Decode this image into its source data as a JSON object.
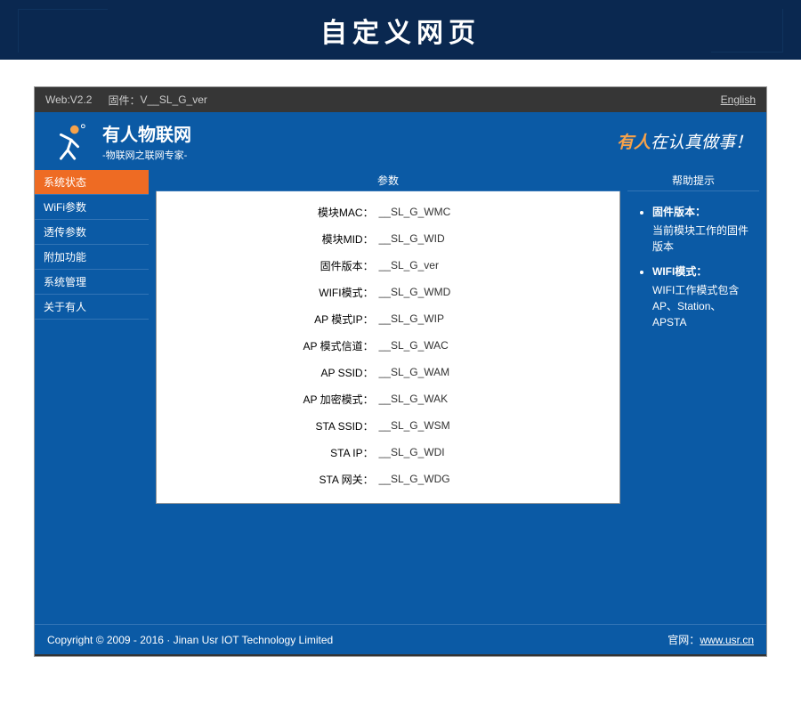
{
  "banner": {
    "title": "自定义网页"
  },
  "topbar": {
    "web": "Web:V2.2",
    "firmware_label": "固件：",
    "firmware_value": "V__SL_G_ver",
    "lang": "English"
  },
  "header": {
    "brand_title": "有人物联网",
    "brand_sub": "-物联网之联网专家-",
    "slogan_highlight": "有人",
    "slogan_rest": "在认真做事！"
  },
  "sidebar": {
    "items": [
      {
        "label": "系统状态",
        "active": true
      },
      {
        "label": "WiFi参数",
        "active": false
      },
      {
        "label": "透传参数",
        "active": false
      },
      {
        "label": "附加功能",
        "active": false
      },
      {
        "label": "系统管理",
        "active": false
      },
      {
        "label": "关于有人",
        "active": false
      }
    ]
  },
  "params": {
    "header": "参数",
    "rows": [
      {
        "label": "模块MAC：",
        "value": "__SL_G_WMC"
      },
      {
        "label": "模块MID：",
        "value": "__SL_G_WID"
      },
      {
        "label": "固件版本：",
        "value": "__SL_G_ver"
      },
      {
        "label": "WIFI模式：",
        "value": "__SL_G_WMD"
      },
      {
        "label": "AP 模式IP：",
        "value": "__SL_G_WIP"
      },
      {
        "label": "AP 模式信道：",
        "value": "__SL_G_WAC"
      },
      {
        "label": "AP SSID：",
        "value": "__SL_G_WAM"
      },
      {
        "label": "AP 加密模式：",
        "value": "__SL_G_WAK"
      },
      {
        "label": "STA SSID：",
        "value": "__SL_G_WSM"
      },
      {
        "label": "STA IP：",
        "value": "__SL_G_WDI"
      },
      {
        "label": "STA 网关：",
        "value": "__SL_G_WDG"
      }
    ]
  },
  "help": {
    "header": "帮助提示",
    "items": [
      {
        "title": "固件版本：",
        "desc": "当前模块工作的固件版本"
      },
      {
        "title": "WIFI模式：",
        "desc": "WIFI工作模式包含AP、Station、APSTA"
      }
    ]
  },
  "footer": {
    "copyright": "Copyright © 2009 - 2016 · Jinan Usr IOT Technology Limited",
    "site_label": "官网：",
    "site_url": "www.usr.cn"
  }
}
